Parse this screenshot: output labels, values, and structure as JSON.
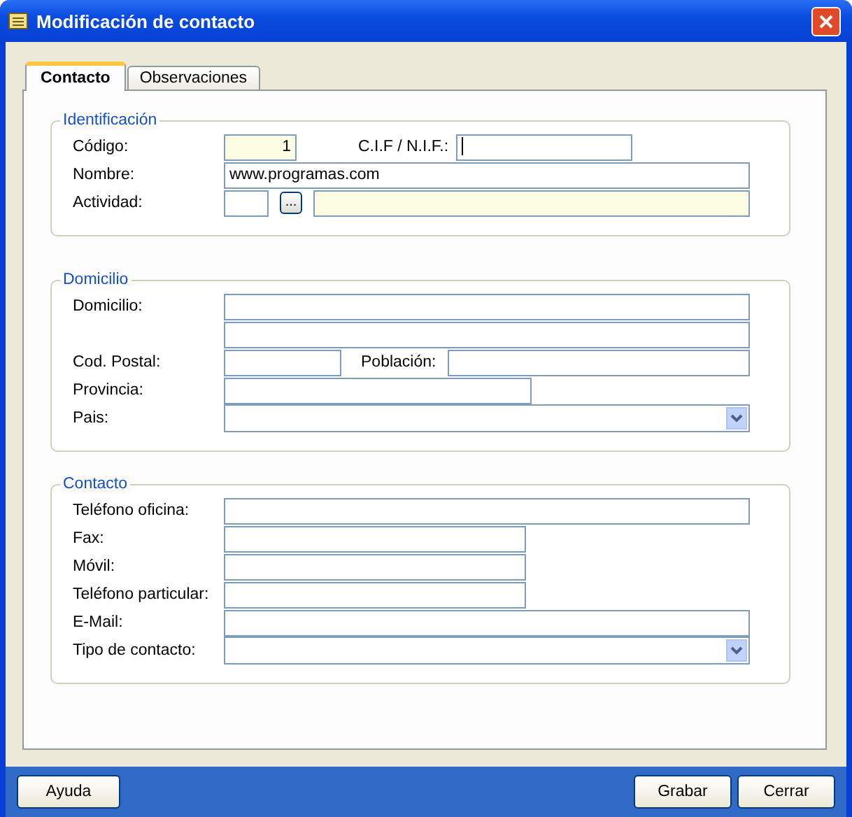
{
  "window": {
    "title": "Modificación de contacto"
  },
  "tabs": [
    {
      "label": "Contacto",
      "selected": true
    },
    {
      "label": "Observaciones",
      "selected": false
    }
  ],
  "groups": [
    {
      "title": "Identificación",
      "rows": [
        {
          "label": "Código:",
          "fields": [
            {
              "kind": "number",
              "value": "1",
              "readonly": true
            },
            {
              "kind": "label",
              "text": "C.I.F / N.I.F.:"
            },
            {
              "kind": "text",
              "readonly": false,
              "focused": true
            }
          ]
        },
        {
          "label": "Nombre:",
          "fields": [
            {
              "kind": "text",
              "value": "www.programas.com",
              "readonly": false
            }
          ]
        },
        {
          "label": "Actividad:",
          "fields": [
            {
              "kind": "text",
              "readonly": false
            },
            {
              "kind": "button",
              "text": "..."
            },
            {
              "kind": "text",
              "readonly": true
            }
          ]
        }
      ]
    },
    {
      "title": "Domicilio",
      "rows": [
        {
          "label": "Domicilio:",
          "fields": [
            {
              "kind": "text",
              "readonly": false
            }
          ]
        },
        {
          "fields": [
            {
              "kind": "text",
              "readonly": false
            }
          ]
        },
        {
          "label": "Cod. Postal:",
          "fields": [
            {
              "kind": "text",
              "readonly": false
            },
            {
              "kind": "label",
              "text": "Población:"
            },
            {
              "kind": "text",
              "readonly": false
            }
          ]
        },
        {
          "label": "Provincia:",
          "fields": [
            {
              "kind": "text",
              "readonly": false
            }
          ]
        },
        {
          "label": "Pais:",
          "fields": [
            {
              "kind": "combo"
            }
          ]
        }
      ]
    },
    {
      "title": "Contacto",
      "rows": [
        {
          "label": "Teléfono oficina:",
          "fields": [
            {
              "kind": "text",
              "readonly": false
            }
          ]
        },
        {
          "label": "Fax:",
          "fields": [
            {
              "kind": "text",
              "readonly": false
            }
          ]
        },
        {
          "label": "Móvil:",
          "fields": [
            {
              "kind": "text",
              "readonly": false
            }
          ]
        },
        {
          "label": "Teléfono particular:",
          "fields": [
            {
              "kind": "text",
              "readonly": false
            }
          ]
        },
        {
          "label": "E-Mail:",
          "fields": [
            {
              "kind": "text",
              "readonly": false
            }
          ]
        },
        {
          "label": "Tipo de contacto:",
          "fields": [
            {
              "kind": "combo"
            }
          ]
        }
      ]
    }
  ],
  "buttons_left": [
    "Ayuda"
  ],
  "buttons_right": [
    "Grabar",
    "Cerrar"
  ]
}
